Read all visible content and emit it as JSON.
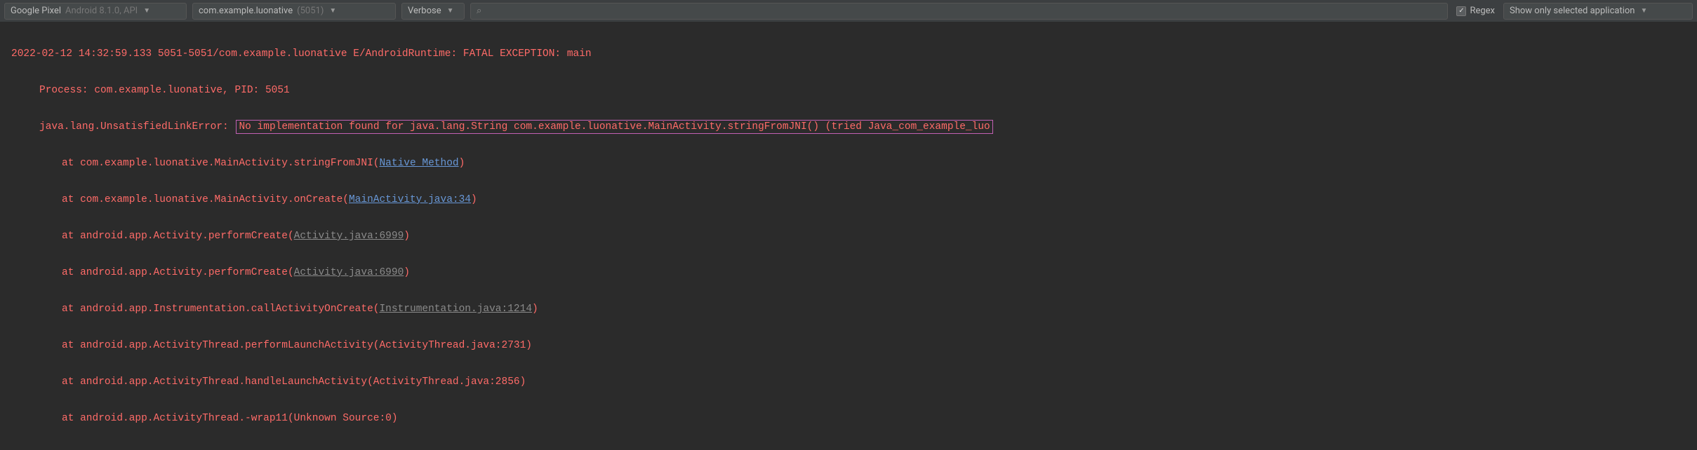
{
  "toolbar": {
    "device": {
      "name": "Google Pixel",
      "os": "Android 8.1.0, API"
    },
    "package": {
      "name": "com.example.luonative",
      "pid": "(5051)"
    },
    "level": "Verbose",
    "search_placeholder": "",
    "regex_label": "Regex",
    "regex_checked": true,
    "filter": "Show only selected application"
  },
  "log": {
    "line0": "2022-02-12 14:32:59.133 5051-5051/com.example.luonative E/AndroidRuntime: FATAL EXCEPTION: main",
    "line1": "Process: com.example.luonative, PID: 5051",
    "line2_prefix": "java.lang.UnsatisfiedLinkError: ",
    "line2_msg": "No implementation found for java.lang.String com.example.luonative.MainActivity.stringFromJNI() (tried Java_com_example_luo",
    "line3_prefix": "at com.example.luonative.MainActivity.stringFromJNI(",
    "line3_link": "Native Method",
    "line4_prefix": "at com.example.luonative.MainActivity.onCreate(",
    "line4_link": "MainActivity.java:34",
    "line5_prefix": "at android.app.Activity.performCreate(",
    "line5_link": "Activity.java:6999",
    "line6_prefix": "at android.app.Activity.performCreate(",
    "line6_link": "Activity.java:6990",
    "line7_prefix": "at android.app.Instrumentation.callActivityOnCreate(",
    "line7_link": "Instrumentation.java:1214",
    "line8": "at android.app.ActivityThread.performLaunchActivity(ActivityThread.java:2731)",
    "line9": "at android.app.ActivityThread.handleLaunchActivity(ActivityThread.java:2856)",
    "line10": "at android.app.ActivityThread.-wrap11(Unknown Source:0)"
  }
}
